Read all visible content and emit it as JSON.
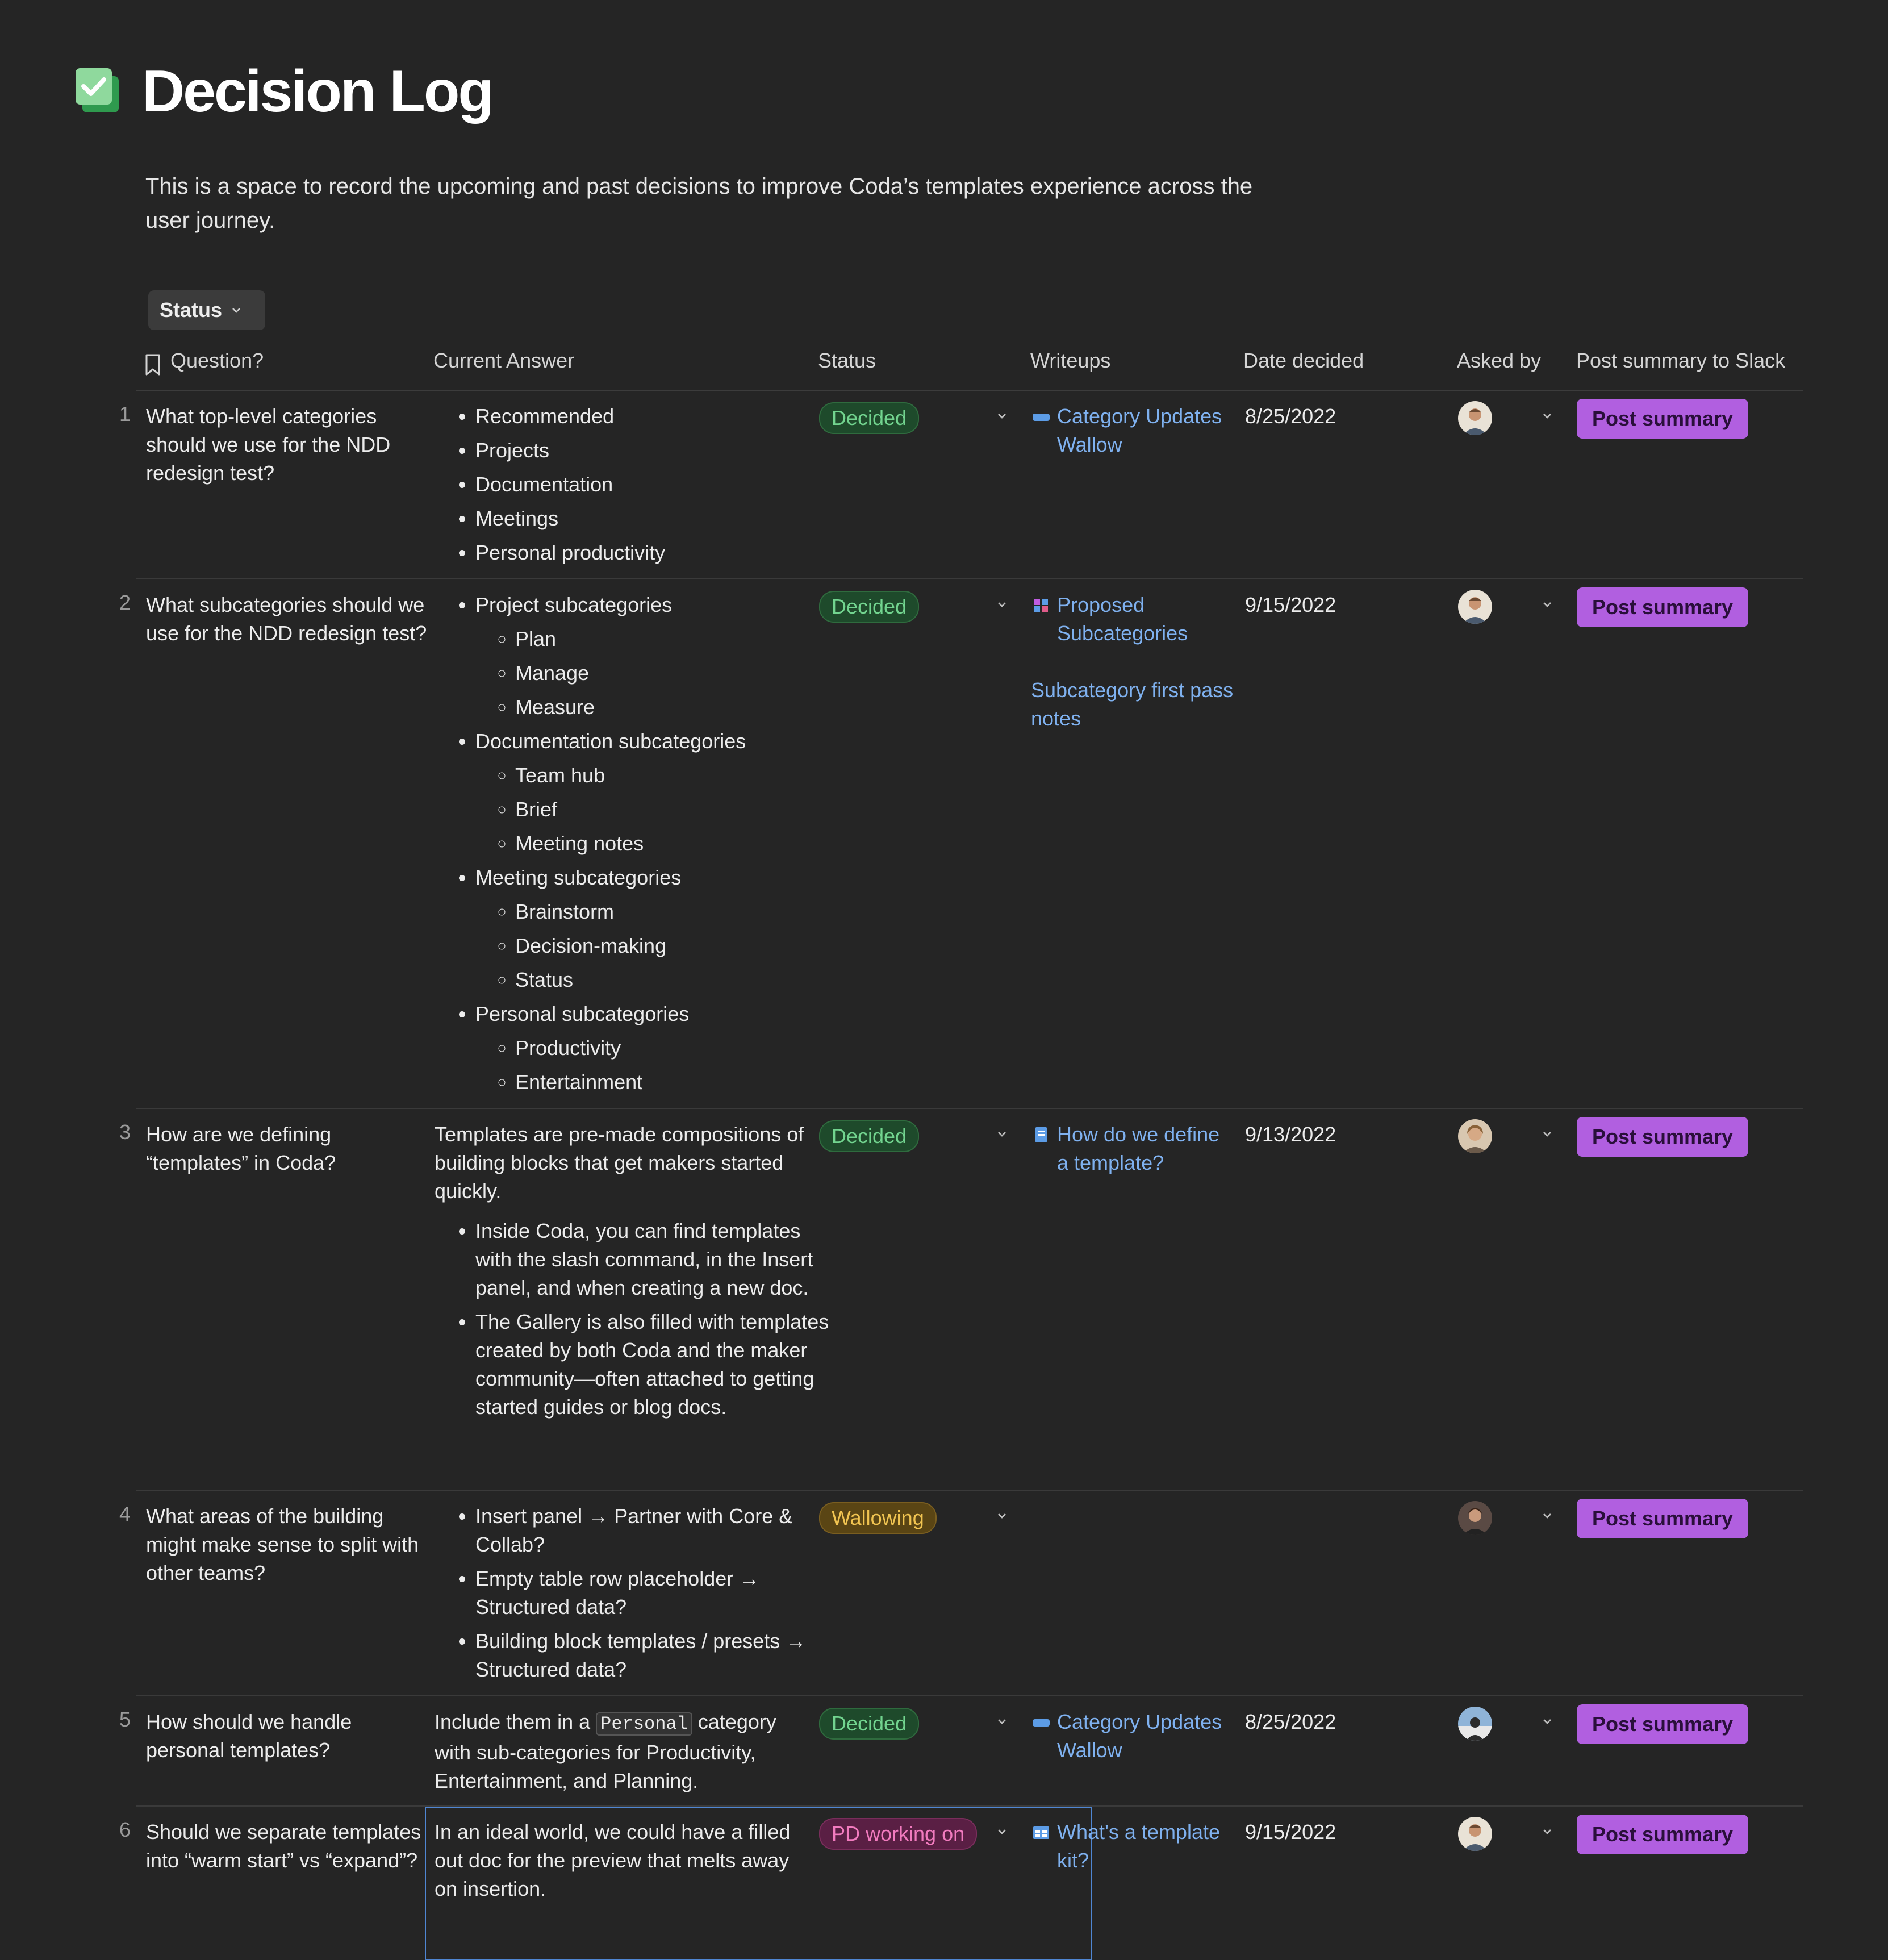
{
  "page": {
    "title": "Decision Log",
    "description": "This is a space to record the upcoming and past decisions to improve Coda’s templates experience across the user journey.",
    "logo_icon": "checkbox-icon"
  },
  "filter": {
    "label": "Status"
  },
  "table": {
    "headers": [
      "Question?",
      "Current Answer",
      "Status",
      "Writeups",
      "Date decided",
      "Asked by",
      "Post summary to Slack"
    ],
    "post_button_label": "Post summary",
    "rows": [
      {
        "num": "1",
        "question": "What top-level categories should we use for the NDD redesign test?",
        "answer_items": [
          "Recommended",
          "Projects",
          "Documentation",
          "Meetings",
          "Personal productivity"
        ],
        "status": "Decided",
        "writeup_1": "Category Updates Wallow",
        "date": "8/25/2022"
      },
      {
        "num": "2",
        "question": "What subcategories should we use for the NDD redesign test?",
        "groups": [
          {
            "title": "Project subcategories",
            "items": [
              "Plan",
              "Manage",
              "Measure"
            ]
          },
          {
            "title": "Documentation subcategories",
            "items": [
              "Team hub",
              "Brief",
              "Meeting notes"
            ]
          },
          {
            "title": "Meeting subcategories",
            "items": [
              "Brainstorm",
              "Decision-making",
              "Status"
            ]
          },
          {
            "title": "Personal subcategories",
            "items": [
              "Productivity",
              "Entertainment"
            ]
          }
        ],
        "status": "Decided",
        "writeup_1": "Proposed Subcategories",
        "writeup_2": "Subcategory first pass notes",
        "date": "9/15/2022"
      },
      {
        "num": "3",
        "question": "How are we defining “templates” in Coda?",
        "answer_text": "Templates are pre-made compositions of building blocks that get makers started quickly.",
        "answer_items": [
          "Inside Coda, you can find templates with the slash command, in the Insert panel, and when creating a new doc.",
          "The Gallery is also filled with templates created by both Coda and the maker community—often attached to getting started guides or blog docs."
        ],
        "status": "Decided",
        "writeup_1": "How do we define a template?",
        "date": "9/13/2022"
      },
      {
        "num": "4",
        "question": "What areas of the building might make sense to split with other teams?",
        "answer_items": [
          "Insert panel → Partner with Core & Collab?",
          "Empty table row placeholder → Structured data?",
          "Building block templates / presets → Structured data?"
        ],
        "status": "Wallowing"
      },
      {
        "num": "5",
        "question": "How should we handle personal templates?",
        "answer_pre": "Include them in a ",
        "answer_code": "Personal",
        "answer_post": " category with sub-categories for Productivity, Entertainment, and Planning.",
        "status": "Decided",
        "writeup_1": "Category Updates Wallow",
        "date": "8/25/2022"
      },
      {
        "num": "6",
        "question": "Should we separate templates into “warm start” vs “expand”?",
        "answer_text": "In an ideal world, we could have a filled out doc for the preview that melts away on insertion.",
        "status": "PD working on",
        "writeup_1": "What's a template kit?",
        "date": "9/15/2022"
      }
    ]
  },
  "colors": {
    "background": "#252525",
    "decided": "#72d48f",
    "wallowing": "#f1c451",
    "pd_working_on": "#f27bbf",
    "link": "#7fb1ef",
    "button": "#b15fe0"
  }
}
